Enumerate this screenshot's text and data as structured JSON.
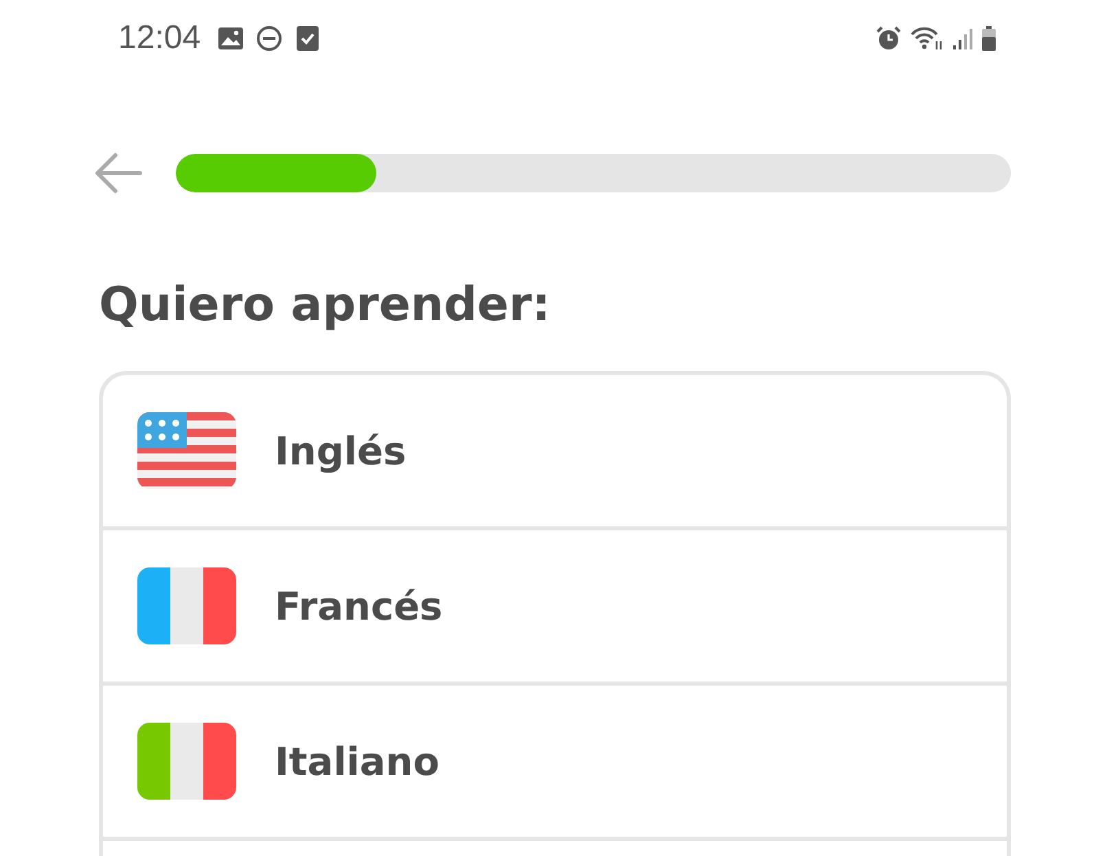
{
  "status_bar": {
    "time": "12:04"
  },
  "progress": {
    "level": 0.24
  },
  "heading": "Quiero aprender:",
  "languages": [
    {
      "name": "Inglés",
      "kind": "us"
    },
    {
      "name": "Francés",
      "kind": "fr"
    },
    {
      "name": "Italiano",
      "kind": "it"
    }
  ]
}
